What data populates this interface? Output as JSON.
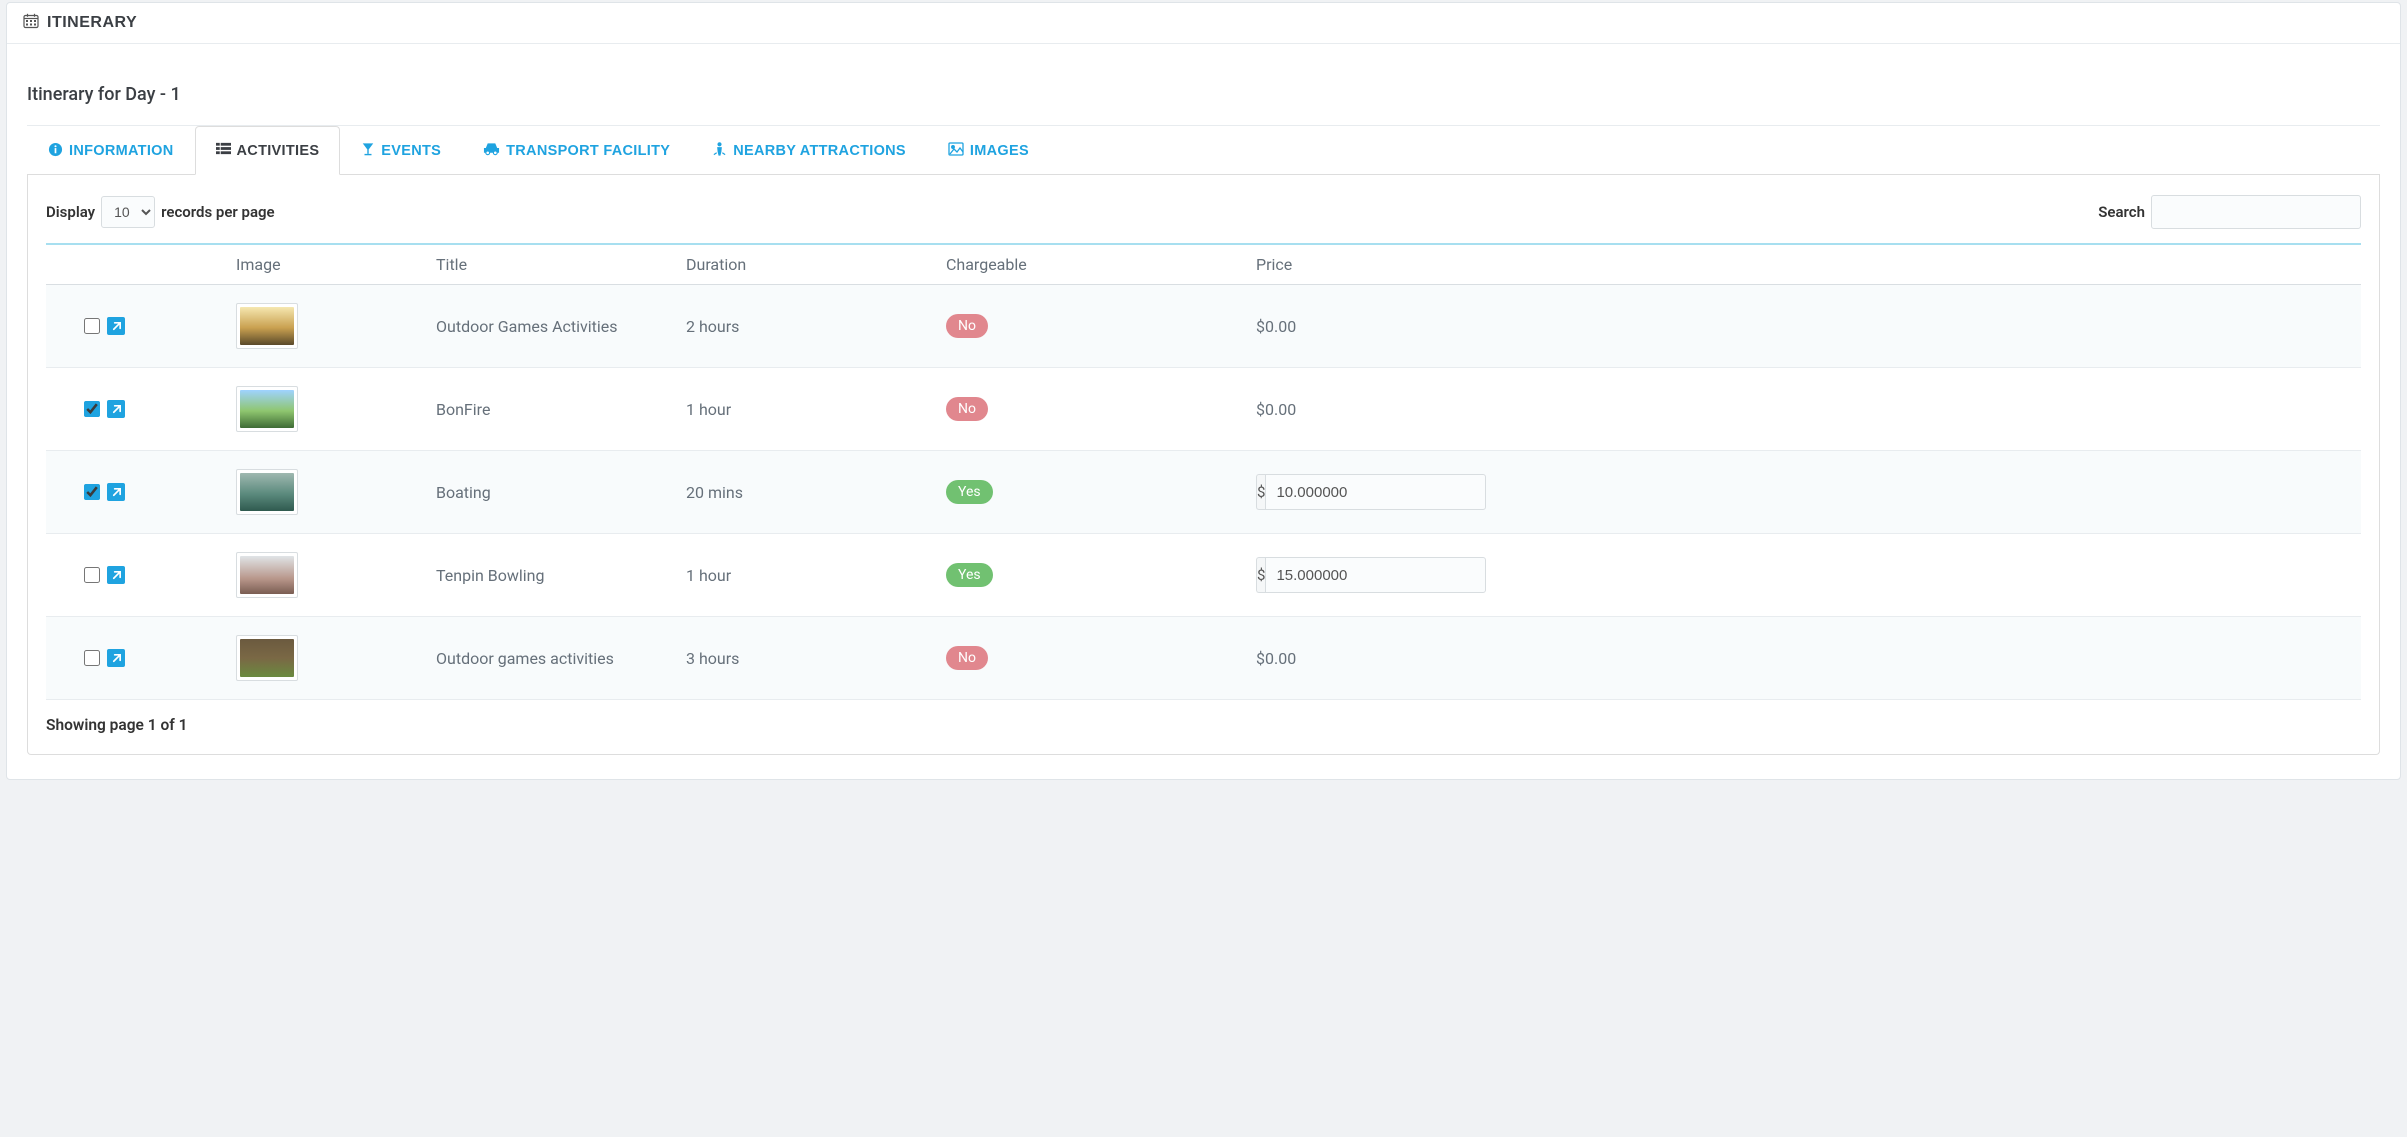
{
  "header": {
    "title": "ITINERARY"
  },
  "subtitle": "Itinerary for Day - 1",
  "tabs": [
    {
      "label": "INFORMATION",
      "icon": "info"
    },
    {
      "label": "ACTIVITIES",
      "icon": "list",
      "active": true
    },
    {
      "label": "EVENTS",
      "icon": "glass"
    },
    {
      "label": "TRANSPORT FACILITY",
      "icon": "car"
    },
    {
      "label": "NEARBY ATTRACTIONS",
      "icon": "street"
    },
    {
      "label": "IMAGES",
      "icon": "image"
    }
  ],
  "datatable": {
    "display_label_pre": "Display",
    "display_label_post": "records per page",
    "display_value": "10",
    "search_label": "Search",
    "search_value": "",
    "columns": [
      "",
      "Image",
      "Title",
      "Duration",
      "Chargeable",
      "Price"
    ],
    "rows": [
      {
        "checked": false,
        "thumb_css": "linear-gradient(180deg,#f5e7b0 0%, #c9a050 55%, #5a4a2a 100%)",
        "title": "Outdoor Games Activities",
        "duration": "2 hours",
        "chargeable": "No",
        "price_text": "$0.00",
        "price_input": null
      },
      {
        "checked": true,
        "thumb_css": "linear-gradient(180deg,#9fd3ff 0%, #8fc66f 55%, #3e6b35 100%)",
        "title": "BonFire",
        "duration": "1 hour",
        "chargeable": "No",
        "price_text": "$0.00",
        "price_input": null
      },
      {
        "checked": true,
        "thumb_css": "linear-gradient(180deg,#9fb8b0 0%, #5b8a7d 55%, #2f5a4f 100%)",
        "title": "Boating",
        "duration": "20 mins",
        "chargeable": "Yes",
        "price_text": null,
        "price_input": "10.000000",
        "currency": "$"
      },
      {
        "checked": false,
        "thumb_css": "linear-gradient(180deg,#e0e4e7 0%, #b8968a 60%, #7a5d52 100%)",
        "title": "Tenpin Bowling",
        "duration": "1 hour",
        "chargeable": "Yes",
        "price_text": null,
        "price_input": "15.000000",
        "currency": "$"
      },
      {
        "checked": false,
        "thumb_css": "linear-gradient(180deg,#6b5a3f 0%, #7a6845 50%, #6a8a3f 100%)",
        "title": "Outdoor games activities",
        "duration": "3 hours",
        "chargeable": "No",
        "price_text": "$0.00",
        "price_input": null
      }
    ],
    "info": "Showing page 1 of 1"
  }
}
